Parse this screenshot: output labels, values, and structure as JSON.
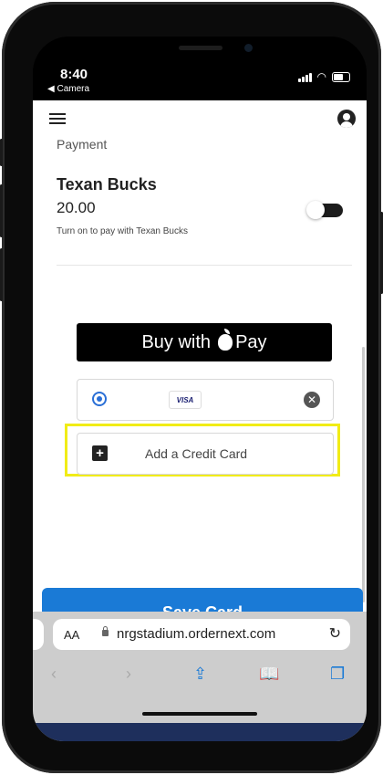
{
  "status_bar": {
    "time": "8:40",
    "back_label": "◀ Camera"
  },
  "app": {
    "section_label": "Payment",
    "texan_bucks": {
      "title": "Texan Bucks",
      "amount": "20.00",
      "hint": "Turn on to pay with Texan Bucks",
      "toggle_on": false
    },
    "apple_pay": {
      "label_prefix": "Buy with",
      "label_suffix": "Pay"
    },
    "saved_card": {
      "brand": "VISA",
      "selected": true
    },
    "add_card_label": "Add a Credit Card",
    "save_button_label": "Save Card",
    "colors": {
      "accent": "#1a7ad6",
      "highlight": "#f1ec16"
    }
  },
  "browser": {
    "aa_label": "AA",
    "url": "nrgstadium.ordernext.com",
    "toolbar_icons": [
      "back-icon",
      "forward-icon",
      "share-icon",
      "bookmarks-icon",
      "tabs-icon"
    ]
  }
}
